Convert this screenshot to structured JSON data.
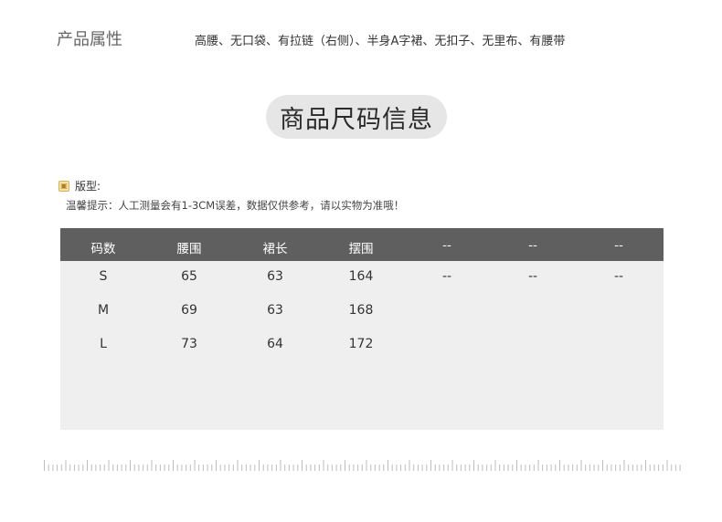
{
  "product_attributes": {
    "label": "产品属性",
    "value": "高腰、无口袋、有拉链（右侧）、半身A字裙、无扣子、无里布、有腰带"
  },
  "section_title": "商品尺码信息",
  "fit": {
    "label": "版型:",
    "tip": "温馨提示：人工测量会有1-3CM误差，数据仅供参考，请以实物为准哦！"
  },
  "size_table": {
    "headers": [
      "码数",
      "腰围",
      "裙长",
      "摆围",
      "--",
      "--",
      "--"
    ],
    "rows": [
      [
        "S",
        "65",
        "63",
        "164",
        "--",
        "--",
        "--"
      ],
      [
        "M",
        "69",
        "63",
        "168",
        "",
        "",
        ""
      ],
      [
        "L",
        "73",
        "64",
        "172",
        "",
        "",
        ""
      ]
    ]
  },
  "colors": {
    "header_bg": "#5f5f5f",
    "table_bg": "#efefef",
    "pill_bg": "#e6e6e6"
  }
}
